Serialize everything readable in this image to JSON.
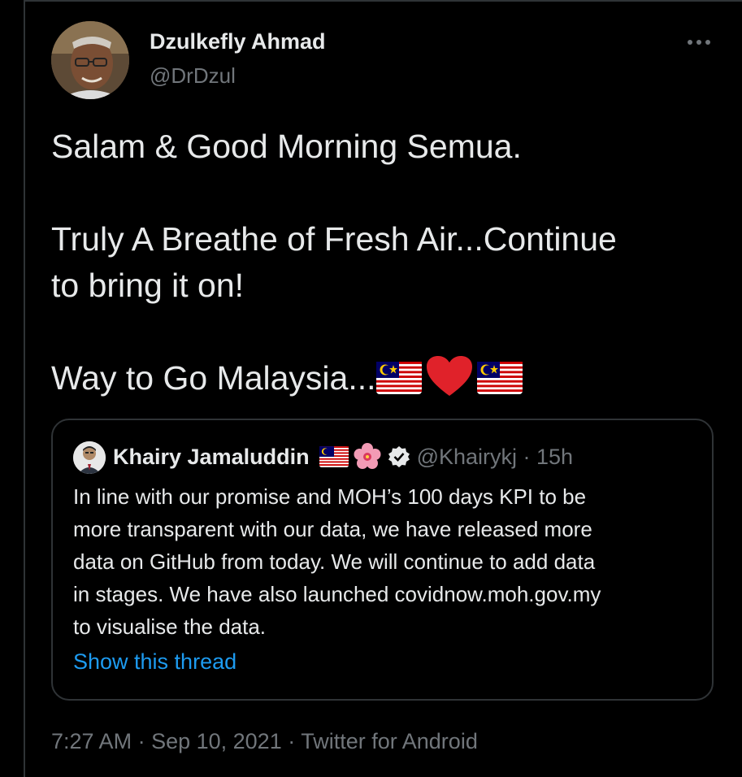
{
  "author": {
    "name": "Dzulkefly Ahmad",
    "handle": "@DrDzul"
  },
  "tweet": {
    "line1": "Salam & Good Morning Semua.",
    "line2": "Truly A Breathe of Fresh Air...Continue",
    "line3": "to bring it on!",
    "line4": "Way to Go Malaysia..."
  },
  "quote": {
    "name": "Khairy Jamaluddin",
    "handle_time": "@Khairykj · 15h",
    "lines": [
      "In line with our promise and MOH’s 100 days KPI to be",
      "more transparent with our data, we have released more",
      "data on GitHub from today. We will continue to add data",
      "in stages. We have also launched covidnow.moh.gov.my",
      "to visualise the data."
    ],
    "show_thread": "Show this thread"
  },
  "meta": {
    "time": "7:27 AM",
    "date": "Sep 10, 2021",
    "source": "Twitter for Android",
    "sep": " · "
  },
  "icons": {
    "more": "more-horizontal-icon",
    "flag": "malaysia-flag-icon",
    "heart": "red-heart-icon",
    "hibiscus": "hibiscus-icon",
    "verified": "verified-badge-icon"
  },
  "colors": {
    "background": "#000000",
    "text": "#e7e9ea",
    "secondary": "#71767b",
    "link": "#1d9bf0",
    "border": "#2f3336"
  }
}
